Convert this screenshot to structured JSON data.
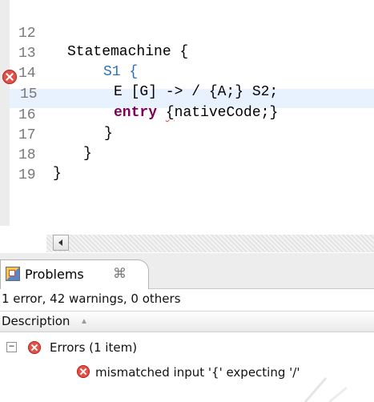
{
  "editor": {
    "lines": [
      {
        "number": "12",
        "code": "Statemachine {"
      },
      {
        "number": "13",
        "code": "S1 {"
      },
      {
        "number": "14",
        "code": "E [G] -> / {A;} S2;"
      },
      {
        "number": "15",
        "keyword": "entry",
        "code_rest_prefix": " ",
        "error_text": "{",
        "code_rest": "nativeCode;}"
      },
      {
        "number": "16",
        "code": "}"
      },
      {
        "number": "17",
        "code": "}"
      },
      {
        "number": "18",
        "code": "}"
      },
      {
        "number": "19",
        "code": ""
      }
    ]
  },
  "problems_view": {
    "tab_label": "Problems",
    "tab_close_symbol": "⌘",
    "summary": "1 error, 42 warnings, 0 others",
    "column_header": "Description",
    "sort_symbol": "▲",
    "groups": [
      {
        "label": "Errors (1 item)",
        "expanded_symbol": "−",
        "items": [
          {
            "label": "mismatched input '{' expecting '/'"
          }
        ]
      }
    ]
  },
  "icons": {
    "error_marker": "error-icon",
    "problems_tab": "problems-view-icon",
    "close": "close-tab-icon",
    "scroll_left": "arrow-left-icon",
    "expand_toggle": "collapse-icon",
    "sort": "sort-ascending-icon"
  },
  "colors": {
    "keyword": "#7f0055",
    "identifier": "#2a6fb8",
    "error": "#e0524a",
    "current_line": "#e8f2fe",
    "line_number": "#787878"
  }
}
